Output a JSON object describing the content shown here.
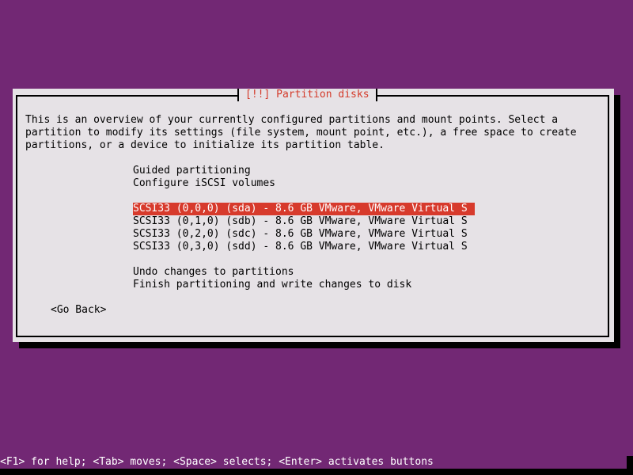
{
  "dialog": {
    "title": "[!!] Partition disks",
    "description": [
      "This is an overview of your currently configured partitions and mount points. Select a",
      "partition to modify its settings (file system, mount point, etc.), a free space to create",
      "partitions, or a device to initialize its partition table."
    ],
    "menu_items": [
      {
        "label": "Guided partitioning",
        "selected": false
      },
      {
        "label": "Configure iSCSI volumes",
        "selected": false
      },
      {
        "label": "SCSI33 (0,0,0) (sda) - 8.6 GB VMware, VMware Virtual S",
        "selected": true
      },
      {
        "label": "SCSI33 (0,1,0) (sdb) - 8.6 GB VMware, VMware Virtual S",
        "selected": false
      },
      {
        "label": "SCSI33 (0,2,0) (sdc) - 8.6 GB VMware, VMware Virtual S",
        "selected": false
      },
      {
        "label": "SCSI33 (0,3,0) (sdd) - 8.6 GB VMware, VMware Virtual S",
        "selected": false
      },
      {
        "label": "Undo changes to partitions",
        "selected": false
      },
      {
        "label": "Finish partitioning and write changes to disk",
        "selected": false
      }
    ],
    "go_back_label": "<Go Back>"
  },
  "footer": {
    "help_text": "<F1> for help; <Tab> moves; <Space> selects; <Enter> activates buttons"
  },
  "colors": {
    "background": "#722874",
    "dialog_bg": "#e6e2e6",
    "title_text": "#d43a2a",
    "selection": "#d73a2c"
  }
}
